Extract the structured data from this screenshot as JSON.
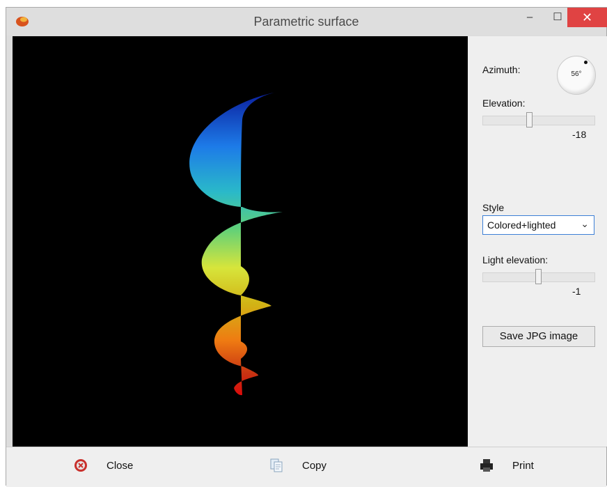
{
  "window": {
    "title": "Parametric surface",
    "controls": {
      "minimize": "–",
      "maximize": "☐",
      "close": "✕"
    }
  },
  "panel": {
    "azimuth": {
      "label": "Azimuth:",
      "value": "56°"
    },
    "elevation": {
      "label": "Elevation:",
      "value": "-18"
    },
    "style": {
      "label": "Style",
      "selected": "Colored+lighted"
    },
    "light_elevation": {
      "label": "Light elevation:",
      "value": "-1"
    },
    "save_button": "Save JPG image"
  },
  "footer": {
    "close_label": "Close",
    "copy_label": "Copy",
    "print_label": "Print"
  },
  "icons": {
    "app": "app-logo-icon",
    "close": "close-circle-icon",
    "copy": "copy-icon",
    "print": "printer-icon",
    "dropdown": "chevron-down-icon"
  }
}
